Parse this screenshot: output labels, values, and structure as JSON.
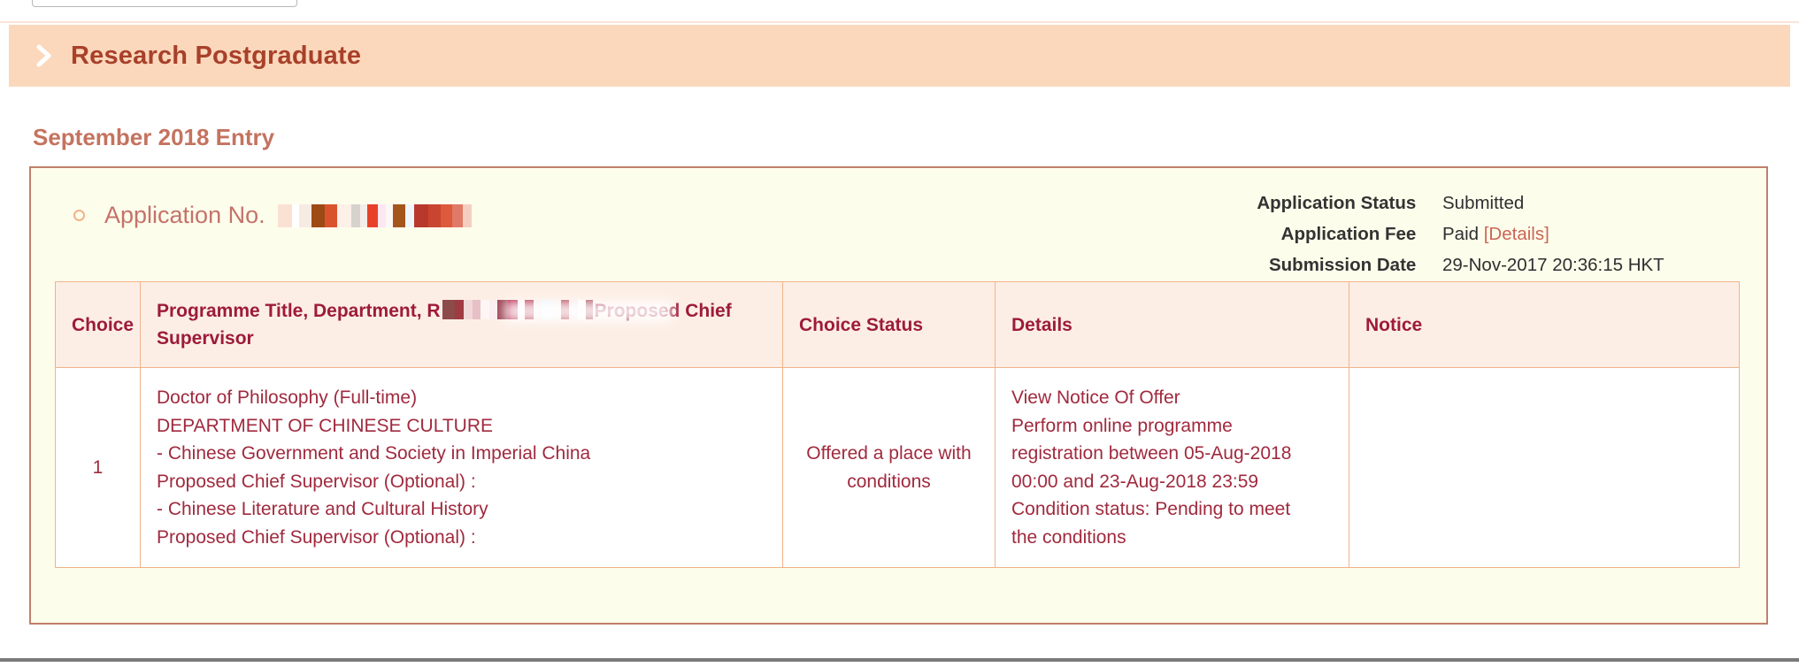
{
  "section": {
    "chevron_icon": "chevron-right-icon",
    "title": "Research Postgraduate"
  },
  "entry_heading": "September 2018 Entry",
  "application": {
    "bullet_icon": "circle-bullet-icon",
    "number_label": "Application No.",
    "number_value_redacted": true,
    "meta": [
      {
        "label": "Application Status",
        "value": "Submitted"
      },
      {
        "label": "Application Fee",
        "value": "Paid",
        "link": "[Details]"
      },
      {
        "label": "Submission Date",
        "value": "29-Nov-2017 20:36:15 HKT"
      }
    ]
  },
  "table": {
    "headers": {
      "choice": "Choice",
      "programme_prefix": "Programme Title, Department, R",
      "programme_suffix": "Proposed Chief Supervisor",
      "programme_redacted": true,
      "status": "Choice Status",
      "details": "Details",
      "notice": "Notice"
    },
    "rows": [
      {
        "choice": "1",
        "programme_lines": [
          "Doctor of Philosophy (Full-time)",
          "DEPARTMENT OF CHINESE CULTURE",
          "- Chinese Government and Society in Imperial China",
          "Proposed Chief Supervisor (Optional) :",
          "- Chinese Literature and Cultural History",
          "Proposed Chief Supervisor (Optional) :"
        ],
        "status": "Offered a place with conditions",
        "details_lines": [
          "View Notice Of Offer",
          "Perform online programme",
          "registration between 05-Aug-2018",
          "00:00 and 23-Aug-2018 23:59",
          "Condition status: Pending to meet",
          "the conditions"
        ],
        "notice": ""
      }
    ]
  },
  "colors": {
    "section_bar_bg": "#fbd8bc",
    "section_title": "#a8402a",
    "entry_heading": "#c4735f",
    "card_bg": "#fdfdec",
    "card_border": "#c07f6a",
    "table_header_bg": "#fdeee5",
    "table_header_text": "#9d1b39",
    "table_border": "#f0b389",
    "body_text": "#a02a3e",
    "details_text": "#c27361",
    "link": "#cc6655"
  }
}
